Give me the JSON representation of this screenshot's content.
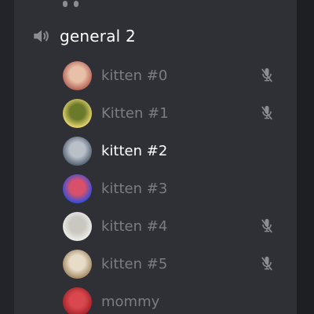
{
  "colors": {
    "panel_bg": "#2f3036",
    "text_active": "#ffffff",
    "text_idle": "#7a7d85",
    "icon": "#8b8d92"
  },
  "channel": {
    "name": "general 2",
    "icon": "speaker-icon"
  },
  "members": [
    {
      "name": "kitten #0",
      "active": false,
      "muted": true,
      "avatar_colors": [
        "#b86a5c",
        "#e8c0a8"
      ]
    },
    {
      "name": "Kitten #1",
      "active": false,
      "muted": true,
      "avatar_colors": [
        "#e3d26a",
        "#6b7a2a"
      ]
    },
    {
      "name": "kitten #2",
      "active": true,
      "muted": false,
      "avatar_colors": [
        "#5d6a7c",
        "#b9c0c8"
      ]
    },
    {
      "name": "kitten #3",
      "active": false,
      "muted": false,
      "avatar_colors": [
        "#3a4fd8",
        "#d8506a"
      ]
    },
    {
      "name": "kitten #4",
      "active": false,
      "muted": true,
      "avatar_colors": [
        "#ecebe6",
        "#c9c7c0"
      ]
    },
    {
      "name": "kitten #5",
      "active": false,
      "muted": true,
      "avatar_colors": [
        "#a88e6a",
        "#e7dcc8"
      ]
    },
    {
      "name": "mommy",
      "active": false,
      "muted": false,
      "avatar_colors": [
        "#a6252b",
        "#d8484e"
      ]
    }
  ]
}
